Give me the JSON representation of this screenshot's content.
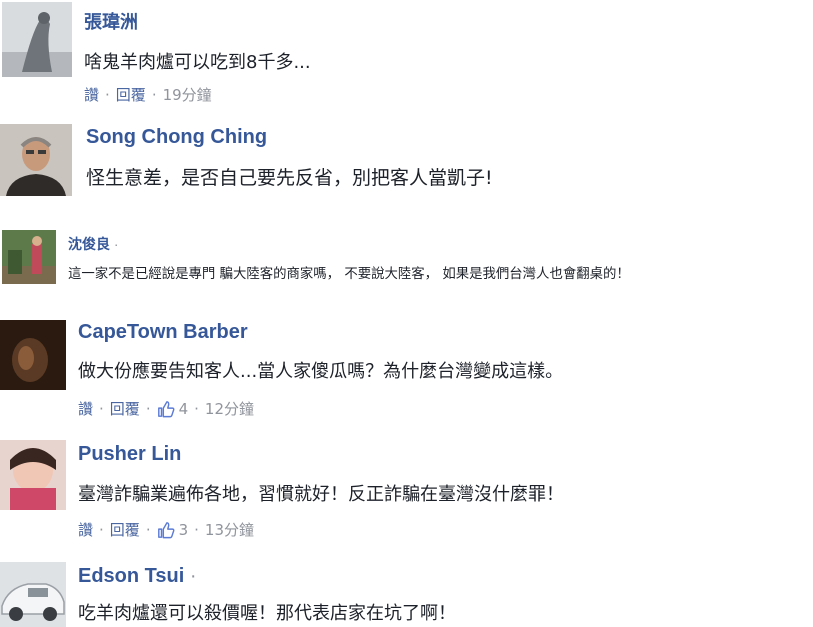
{
  "comments": [
    {
      "name": "張瑋洲",
      "text": "啥鬼羊肉爐可以吃到8千多...",
      "actions": {
        "like": "讚",
        "reply": "回覆",
        "time": "19分鐘"
      }
    },
    {
      "name": "Song Chong Ching",
      "text": "怪生意差，是否自己要先反省，別把客人當凱子!"
    },
    {
      "name": "沈俊良",
      "name_suffix": "·",
      "text": "這一家不是已經說是專門 騙大陸客的商家嗎， 不要說大陸客， 如果是我們台灣人也會翻桌的！"
    },
    {
      "name": "CapeTown Barber",
      "text": "做大份應要告知客人...當人家傻瓜嗎？為什麼台灣變成這樣。",
      "actions": {
        "like": "讚",
        "reply": "回覆",
        "likes": "4",
        "time": "12分鐘"
      }
    },
    {
      "name": "Pusher Lin",
      "text": "臺灣詐騙業遍佈各地，習慣就好！反正詐騙在臺灣沒什麼罪！",
      "actions": {
        "like": "讚",
        "reply": "回覆",
        "likes": "3",
        "time": "13分鐘"
      }
    },
    {
      "name": "Edson Tsui",
      "name_suffix": "·",
      "text": "吃羊肉爐還可以殺價喔！那代表店家在坑了啊！"
    }
  ],
  "colors": {
    "name": "#365899",
    "text": "#1d2129",
    "action_link": "#4b67a1",
    "meta": "#90949c",
    "like_blue": "#5b7bd5"
  },
  "icons": {
    "like": "thumbs-up-icon"
  }
}
